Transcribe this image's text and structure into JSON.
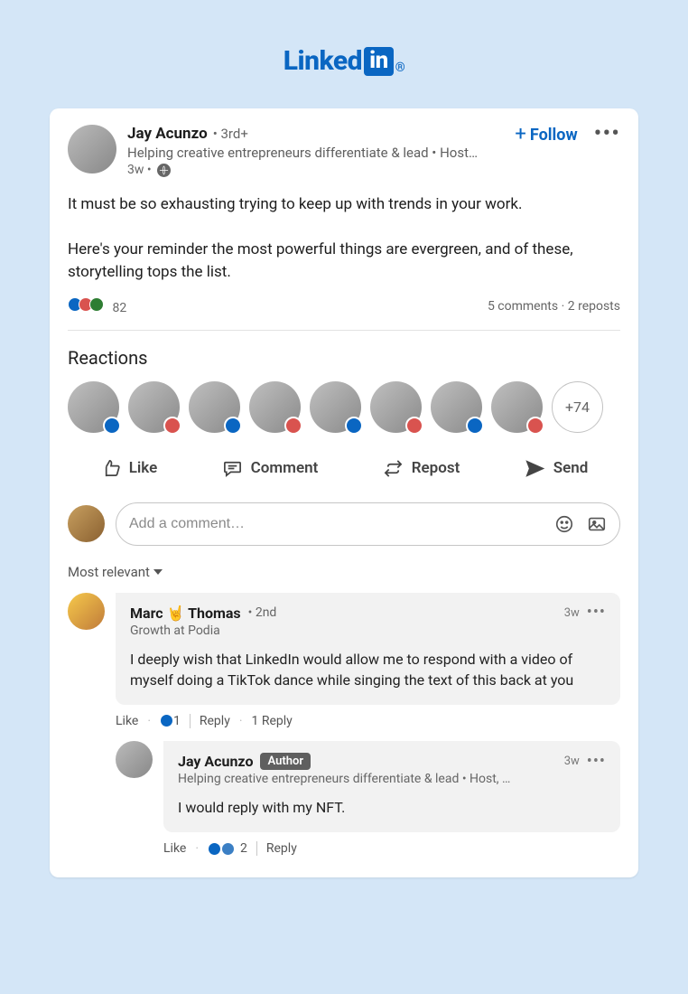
{
  "brand": {
    "name": "Linked",
    "suffix": "in"
  },
  "header": {
    "follow_label": "Follow"
  },
  "post": {
    "author": {
      "name": "Jay Acunzo",
      "degree": "• 3rd+",
      "tagline": "Helping creative entrepreneurs differentiate & lead • Host…",
      "time": "3w •"
    },
    "body": {
      "p1": "It must be so exhausting trying to keep up with trends in your work.",
      "p2": "Here's your reminder the most powerful things are evergreen, and of these, storytelling tops the list."
    },
    "engagement": {
      "reaction_count": "82",
      "comments": "5 comments",
      "reposts": "2 reposts"
    }
  },
  "reactions": {
    "heading": "Reactions",
    "more_count": "+74"
  },
  "actions": {
    "like": "Like",
    "comment": "Comment",
    "repost": "Repost",
    "send": "Send"
  },
  "comment_box": {
    "placeholder": "Add a comment…"
  },
  "sort": {
    "label": "Most relevant"
  },
  "comments": {
    "c1": {
      "name": "Marc 🤘 Thomas",
      "degree": "• 2nd",
      "sub": "Growth at Podia",
      "time": "3w",
      "body": "I deeply wish that LinkedIn would allow me to respond with a video of myself doing a TikTok dance while singing the text of this back at you",
      "like": "Like",
      "react_count": "1",
      "reply": "Reply",
      "reply_count": "1 Reply"
    },
    "c2": {
      "name": "Jay Acunzo",
      "author_badge": "Author",
      "sub": "Helping creative entrepreneurs differentiate & lead • Host, …",
      "time": "3w",
      "body": "I would reply with my NFT.",
      "like": "Like",
      "react_count": "2",
      "reply": "Reply"
    }
  }
}
